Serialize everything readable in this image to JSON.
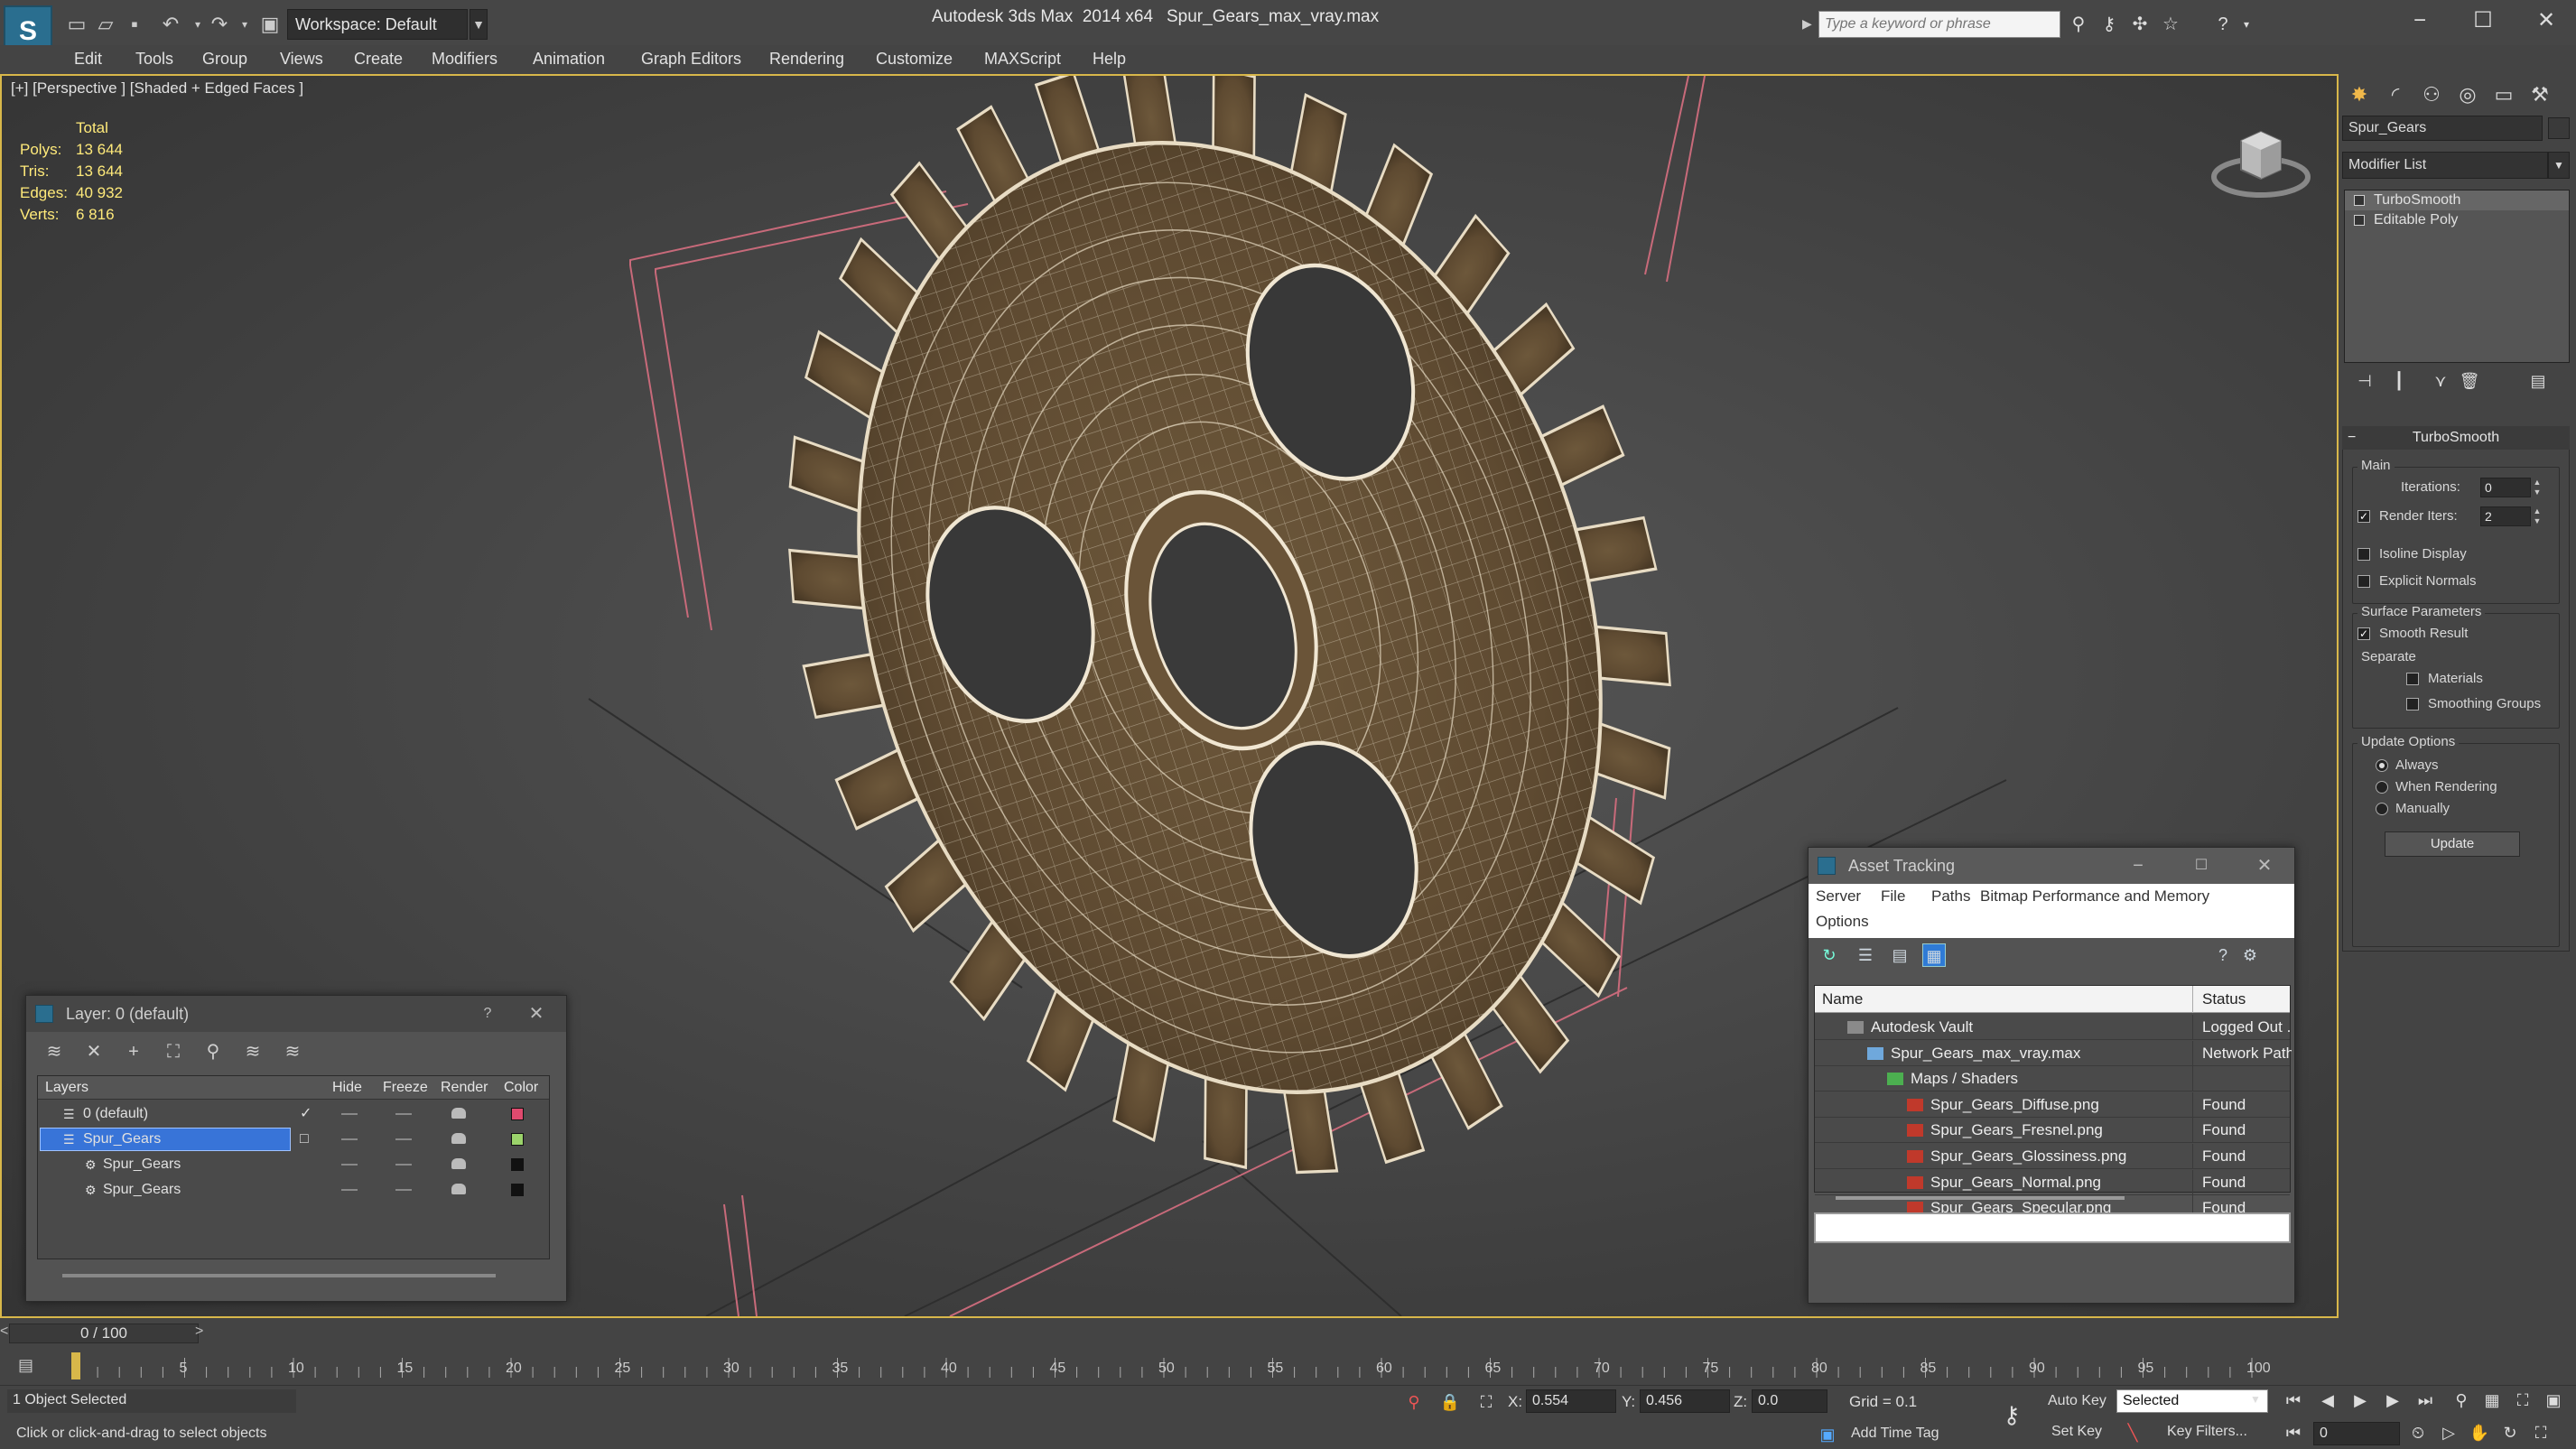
{
  "app": {
    "logo": "S",
    "title": "Autodesk 3ds Max  2014 x64",
    "document": "Spur_Gears_max_vray.max",
    "workspace": "Workspace: Default",
    "search_placeholder": "Type a keyword or phrase"
  },
  "menu": [
    "Edit",
    "Tools",
    "Group",
    "Views",
    "Create",
    "Modifiers",
    "Animation",
    "Graph Editors",
    "Rendering",
    "Customize",
    "MAXScript",
    "Help"
  ],
  "viewport": {
    "label": "[+] [Perspective ] [Shaded + Edged Faces ]",
    "stats": {
      "total_label": "Total",
      "rows": [
        {
          "k": "Polys:",
          "v": "13 644"
        },
        {
          "k": "Tris:",
          "v": "13 644"
        },
        {
          "k": "Edges:",
          "v": "40 932"
        },
        {
          "k": "Verts:",
          "v": "6 816"
        }
      ]
    }
  },
  "command_panel": {
    "object_name": "Spur_Gears",
    "modifier_list": "Modifier List",
    "stack": [
      "TurboSmooth",
      "Editable Poly"
    ],
    "turbosmooth": {
      "title": "TurboSmooth",
      "main_group": "Main",
      "iterations_label": "Iterations:",
      "iterations_value": "0",
      "render_iters_label": "Render Iters:",
      "render_iters_value": "2",
      "render_iters_checked": true,
      "isoline_label": "Isoline Display",
      "explicit_normals_label": "Explicit Normals",
      "surface_group": "Surface Parameters",
      "smooth_result_label": "Smooth Result",
      "smooth_result_checked": true,
      "separate_label": "Separate",
      "materials_label": "Materials",
      "smoothing_groups_label": "Smoothing Groups",
      "update_group": "Update Options",
      "always_label": "Always",
      "when_rendering_label": "When Rendering",
      "manually_label": "Manually",
      "update_button": "Update"
    }
  },
  "layer_window": {
    "title": "Layer: 0 (default)",
    "help": "?",
    "columns": [
      "Layers",
      "Hide",
      "Freeze",
      "Render",
      "Color"
    ],
    "rows": [
      {
        "name": "0 (default)",
        "check": "✓",
        "color": "#e04a6e",
        "selected": false,
        "indent": 1
      },
      {
        "name": "Spur_Gears",
        "check": "□",
        "color": "#9bd36b",
        "selected": true,
        "indent": 1
      },
      {
        "name": "Spur_Gears",
        "check": "",
        "color": "#111111",
        "selected": false,
        "indent": 2
      },
      {
        "name": "Spur_Gears",
        "check": "",
        "color": "#111111",
        "selected": false,
        "indent": 2
      }
    ]
  },
  "asset_window": {
    "title": "Asset Tracking",
    "menu": [
      "Server",
      "File",
      "Paths",
      "Bitmap Performance and Memory",
      "Options"
    ],
    "columns": [
      "Name",
      "Status"
    ],
    "rows": [
      {
        "name": "Autodesk Vault",
        "status": "Logged Out ...",
        "indent": 1,
        "icon": "vault-icon"
      },
      {
        "name": "Spur_Gears_max_vray.max",
        "status": "Network Path",
        "indent": 2,
        "icon": "max-file-icon"
      },
      {
        "name": "Maps / Shaders",
        "status": "",
        "indent": 3,
        "icon": "maps-icon"
      },
      {
        "name": "Spur_Gears_Diffuse.png",
        "status": "Found",
        "indent": 4,
        "icon": "png-icon"
      },
      {
        "name": "Spur_Gears_Fresnel.png",
        "status": "Found",
        "indent": 4,
        "icon": "png-icon"
      },
      {
        "name": "Spur_Gears_Glossiness.png",
        "status": "Found",
        "indent": 4,
        "icon": "png-icon"
      },
      {
        "name": "Spur_Gears_Normal.png",
        "status": "Found",
        "indent": 4,
        "icon": "png-icon"
      },
      {
        "name": "Spur_Gears_Specular.png",
        "status": "Found",
        "indent": 4,
        "icon": "png-icon"
      }
    ]
  },
  "timeline": {
    "frame": "0 / 100",
    "prev": "<",
    "next": ">",
    "ticks": [
      5,
      10,
      15,
      20,
      25,
      30,
      35,
      40,
      45,
      50,
      55,
      60,
      65,
      70,
      75,
      80,
      85,
      90,
      95,
      100
    ],
    "max_frame": 100
  },
  "status": {
    "selection": "1 Object Selected",
    "prompt": "Click or click-and-drag to select objects",
    "x_label": "X:",
    "x_value": "0.554",
    "y_label": "Y:",
    "y_value": "0.456",
    "z_label": "Z:",
    "z_value": "0.0",
    "grid": "Grid = 0.1",
    "add_time_tag": "Add Time Tag",
    "auto_key": "Auto Key",
    "set_key": "Set Key",
    "selected_dropdown": "Selected",
    "key_filters": "Key Filters...",
    "frame_field": "0"
  },
  "colors": {
    "accent": "#d8b74a",
    "selection": "#3874d8",
    "gear": "#6b5538"
  }
}
